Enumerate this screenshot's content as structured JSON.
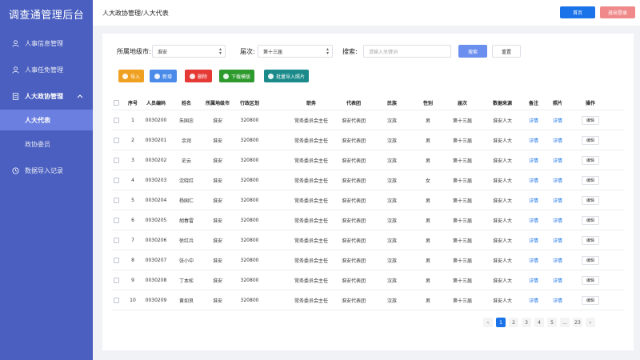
{
  "app": {
    "title": "调查通管理后台"
  },
  "sidebar": {
    "items": [
      {
        "label": "人事信息管理",
        "icon": "user-icon"
      },
      {
        "label": "人事任免管理",
        "icon": "user-icon"
      },
      {
        "label": "人大政协管理",
        "icon": "document-icon",
        "expanded": true
      },
      {
        "label": "数据导入记录",
        "icon": "clock-icon"
      }
    ],
    "subitems": [
      {
        "label": "人大代表",
        "active": true
      },
      {
        "label": "政协委员",
        "active": false
      }
    ]
  },
  "header": {
    "breadcrumb": "人大政协管理/人大代表",
    "home_label": "首页",
    "logout_label": "退出登录"
  },
  "filters": {
    "city_label": "所属地级市:",
    "city_value": "淮安",
    "session_label": "届次:",
    "session_value": "第十三届",
    "search_label": "搜索:",
    "search_placeholder": "请输入关键词",
    "search_button": "搜索",
    "reset_button": "重置"
  },
  "actions": {
    "import": "导入",
    "add": "新增",
    "delete": "删除",
    "template": "下载模版",
    "batch_photo": "批量导入照片"
  },
  "table": {
    "columns": [
      "序号",
      "人员编码",
      "姓名",
      "所属地级市",
      "行政区划",
      "职务",
      "代表团",
      "民族",
      "性别",
      "届次",
      "数据来源",
      "备注",
      "照片",
      "操作"
    ],
    "rows": [
      {
        "no": "1",
        "code": "0030200",
        "name": "朱国忠",
        "city": "淮安",
        "region": "320800",
        "duty": "常务委员会主任",
        "delegation": "淮安代表团",
        "ethnic": "汉族",
        "gender": "男",
        "session": "第十三届",
        "source": "淮安人大",
        "note": "详情",
        "photo": "详情",
        "op": "编辑"
      },
      {
        "no": "2",
        "code": "0030201",
        "name": "余润",
        "city": "淮安",
        "region": "320800",
        "duty": "常务委员会主任",
        "delegation": "淮安代表团",
        "ethnic": "汉族",
        "gender": "男",
        "session": "第十三届",
        "source": "淮安人大",
        "note": "详情",
        "photo": "详情",
        "op": "编辑"
      },
      {
        "no": "3",
        "code": "0030202",
        "name": "史云",
        "city": "淮安",
        "region": "320800",
        "duty": "常务委员会主任",
        "delegation": "淮安代表团",
        "ethnic": "汉族",
        "gender": "男",
        "session": "第十三届",
        "source": "淮安人大",
        "note": "详情",
        "photo": "详情",
        "op": "编辑"
      },
      {
        "no": "4",
        "code": "0030203",
        "name": "沈晓红",
        "city": "淮安",
        "region": "320800",
        "duty": "常务委员会主任",
        "delegation": "淮安代表团",
        "ethnic": "汉族",
        "gender": "女",
        "session": "第十三届",
        "source": "淮安人大",
        "note": "详情",
        "photo": "详情",
        "op": "编辑"
      },
      {
        "no": "5",
        "code": "0030204",
        "name": "杨国仁",
        "city": "淮安",
        "region": "320800",
        "duty": "常务委员会主任",
        "delegation": "淮安代表团",
        "ethnic": "汉族",
        "gender": "男",
        "session": "第十三届",
        "source": "淮安人大",
        "note": "详情",
        "photo": "详情",
        "op": "编辑"
      },
      {
        "no": "6",
        "code": "0030205",
        "name": "胡春雷",
        "city": "淮安",
        "region": "320800",
        "duty": "常务委员会主任",
        "delegation": "淮安代表团",
        "ethnic": "汉族",
        "gender": "男",
        "session": "第十三届",
        "source": "淮安人大",
        "note": "详情",
        "photo": "详情",
        "op": "编辑"
      },
      {
        "no": "7",
        "code": "0030206",
        "name": "徐红兵",
        "city": "淮安",
        "region": "320800",
        "duty": "常务委员会主任",
        "delegation": "淮安代表团",
        "ethnic": "汉族",
        "gender": "男",
        "session": "第十三届",
        "source": "淮安人大",
        "note": "详情",
        "photo": "详情",
        "op": "编辑"
      },
      {
        "no": "8",
        "code": "0030207",
        "name": "张小中",
        "city": "淮安",
        "region": "320800",
        "duty": "常务委员会主任",
        "delegation": "淮安代表团",
        "ethnic": "汉族",
        "gender": "男",
        "session": "第十三届",
        "source": "淮安人大",
        "note": "详情",
        "photo": "详情",
        "op": "编辑"
      },
      {
        "no": "9",
        "code": "0030208",
        "name": "丁本松",
        "city": "淮安",
        "region": "320800",
        "duty": "常务委员会主任",
        "delegation": "淮安代表团",
        "ethnic": "汉族",
        "gender": "男",
        "session": "第十三届",
        "source": "淮安人大",
        "note": "详情",
        "photo": "详情",
        "op": "编辑"
      },
      {
        "no": "10",
        "code": "0030209",
        "name": "黄如良",
        "city": "淮安",
        "region": "320800",
        "duty": "常务委员会主任",
        "delegation": "淮安代表团",
        "ethnic": "汉族",
        "gender": "男",
        "session": "第十三届",
        "source": "淮安人大",
        "note": "详情",
        "photo": "详情",
        "op": "编辑"
      }
    ]
  },
  "pagination": {
    "pages": [
      "1",
      "2",
      "3",
      "4",
      "5",
      "...",
      "23"
    ],
    "current": "1",
    "prev": "‹",
    "next": "›"
  },
  "colors": {
    "sidebar": "#4a5fbf",
    "sidebar_active": "#6b7fe0",
    "primary": "#1a73e8"
  }
}
